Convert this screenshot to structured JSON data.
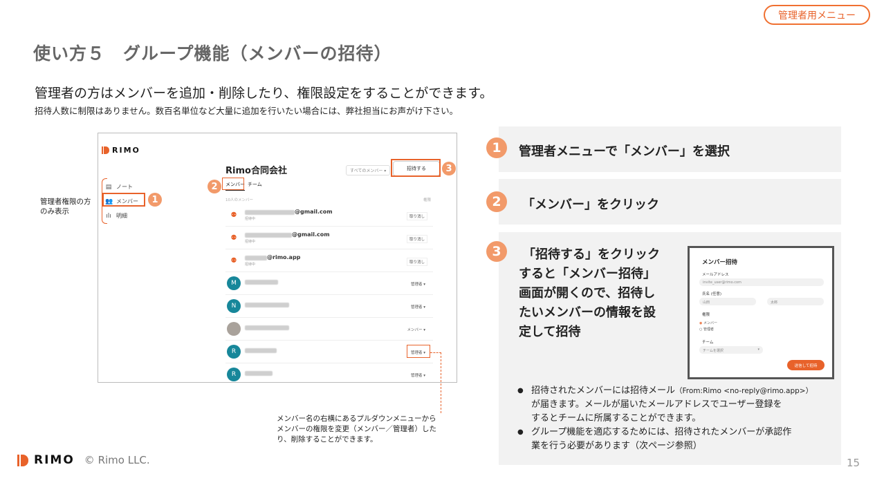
{
  "badge": "管理者用メニュー",
  "title": "使い方５　グループ機能（メンバーの招待）",
  "lead": "管理者の方はメンバーを追加・削除したり、権限設定をすることができます。",
  "sublead": "招待人数に制限はありません。数百名単位など大量に追加を行いたい場合には、弊社担当にお声がけ下さい。",
  "mock": {
    "logo": "RIMO",
    "sidebar": [
      "ノート",
      "メンバー",
      "明細"
    ],
    "org_name": "Rimo合同会社",
    "filter": "すべてのメンバー ▾",
    "invite_button": "招待する",
    "tabs": [
      "メンバー",
      "チーム"
    ],
    "count": "10人のメンバー",
    "role_header": "権限",
    "rows": [
      {
        "avatar": "⚉",
        "suffix": "@gmail.com",
        "status": "招待中",
        "action": "取り消し"
      },
      {
        "avatar": "⚉",
        "suffix": "@gmail.com",
        "status": "招待中",
        "action": "取り消し"
      },
      {
        "avatar": "⚉",
        "suffix": "@rimo.app",
        "status": "招待中",
        "action": "取り消し"
      },
      {
        "avatar": "M",
        "action": "管理者 ▾"
      },
      {
        "avatar": "N",
        "action": "管理者 ▾"
      },
      {
        "avatar": "",
        "action": "メンバー ▾"
      },
      {
        "avatar": "R",
        "action": "管理者 ▾"
      },
      {
        "avatar": "R",
        "action": "管理者 ▾"
      }
    ]
  },
  "side_note": [
    "管理者権限の方",
    "のみ表示"
  ],
  "bottom_note": [
    "メンバー名の右横にあるプルダウンメニューから",
    "メンバーの権限を変更（メンバー／管理者）した",
    "り、削除することができます。"
  ],
  "steps": {
    "s1": {
      "num": "1",
      "text": "管理者メニューで「メンバー」を選択"
    },
    "s2": {
      "num": "2",
      "text": "「メンバー」をクリック"
    },
    "s3": {
      "num": "3",
      "lines": [
        "「招待する」をクリック",
        "すると「メンバー招待」",
        "画面が開くので、招待し",
        "たいメンバーの情報を設",
        "定して招待"
      ]
    }
  },
  "modal": {
    "title": "メンバー招待",
    "email_label": "メールアドレス",
    "email_placeholder": "invite_user@rimo.com",
    "name_label": "氏名 (任意)",
    "last_name": "山田",
    "first_name": "太郎",
    "role_label": "権限",
    "role_member": "メンバー",
    "role_admin": "管理者",
    "team_label": "チーム",
    "team_placeholder": "チームを選択",
    "submit": "送信して招待"
  },
  "bullets": {
    "b1_a": "招待されたメンバーには招待メール",
    "b1_from": "（From:Rimo <no-reply@rimo.app>）",
    "b1_b": "が届きます。メールが届いたメールアドレスでユーザー登録を",
    "b1_c": "するとチームに所属することができます。",
    "b2_a": "グループ機能を適応するためには、招待されたメンバーが承認作",
    "b2_b": "業を行う必要があります（次ページ参照）"
  },
  "footer": {
    "logo": "RIMO",
    "copyright": "© Rimo LLC.",
    "page": "15"
  },
  "colors": {
    "accent": "#e8622a",
    "step": "#f29a6a",
    "panel": "#f2f2f2",
    "avatar": "#17879a"
  }
}
